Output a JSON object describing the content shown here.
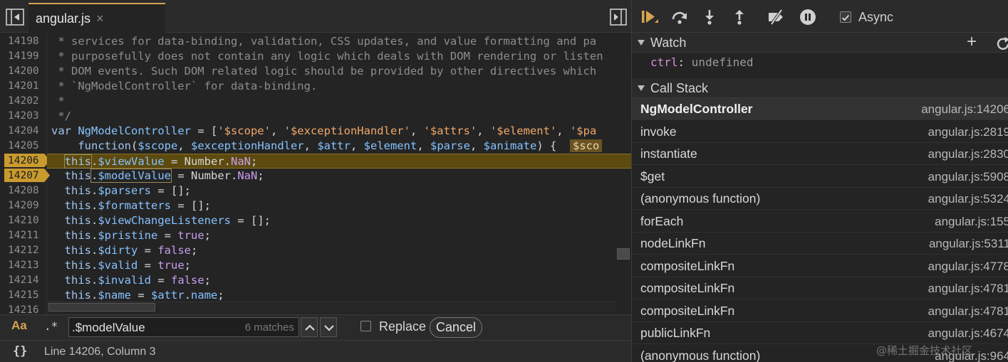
{
  "editor": {
    "file_tab": {
      "name": "angular.js",
      "close": "×"
    },
    "gutter": [
      "14198",
      "14199",
      "14200",
      "14201",
      "14202",
      "14203",
      "14204",
      "14205",
      "14206",
      "14207",
      "14208",
      "14209",
      "14210",
      "14211",
      "14212",
      "14213",
      "14214",
      "14215",
      "14216"
    ],
    "breakpoints": [
      "14206",
      "14207"
    ],
    "code": {
      "l14197": " * services for data-binding, validation, CSS updates, and value formatting and pa",
      "l14198": " * purposefully does not contain any logic which deals with DOM rendering or listen",
      "l14199": " * DOM events. Such DOM related logic should be provided by other directives which",
      "l14200": " * `NgModelController` for data-binding.",
      "l14201": " *",
      "l14202": " */",
      "l14204_kw": "var",
      "l14204_id": "NgModelController",
      "l14204_eq": " = [",
      "l14204_s1": "'$scope'",
      "l14204_s2": "'$exceptionHandler'",
      "l14204_s3": "'$attrs'",
      "l14204_s4": "'$element'",
      "l14204_s5": "'$pa",
      "l14205_fn": "function",
      "l14205_p1": "$scope",
      "l14205_p2": "$exceptionHandler",
      "l14205_p3": "$attr",
      "l14205_p4": "$element",
      "l14205_p5": "$parse",
      "l14205_p6": "$animate",
      "l14205_inline": "$sco",
      "this": "this",
      "viewValue": "$viewValue",
      "modelValue": "$modelValue",
      "parsers": "$parsers",
      "formatters": "$formatters",
      "listeners": "$viewChangeListeners",
      "pristine": "$pristine",
      "dirty": "$dirty",
      "valid": "$valid",
      "invalid": "$invalid",
      "name": "$name",
      "attr": "$attr",
      "attr_name": "name",
      "number": "Number",
      "nan": "NaN",
      "true_kw": "true",
      "false_kw": "false",
      "empty_arr": "[]"
    },
    "search": {
      "case_label": "Aa",
      "regex_label": ".*",
      "value": ".$modelValue",
      "matches": "6 matches",
      "replace_label": "Replace",
      "cancel_label": "Cancel"
    },
    "status": {
      "braces": "{}",
      "cursor": "Line 14206, Column 3"
    }
  },
  "debugger": {
    "async_label": "Async",
    "watch": {
      "title": "Watch",
      "add": "+",
      "items": [
        {
          "name": "ctrl",
          "sep": ": ",
          "value": "undefined"
        }
      ]
    },
    "call_stack": {
      "title": "Call Stack",
      "frames": [
        {
          "name": "NgModelController",
          "loc": "angular.js:14206"
        },
        {
          "name": "invoke",
          "loc": "angular.js:2819"
        },
        {
          "name": "instantiate",
          "loc": "angular.js:2830"
        },
        {
          "name": "$get",
          "loc": "angular.js:5908"
        },
        {
          "name": "(anonymous function)",
          "loc": "angular.js:5324"
        },
        {
          "name": "forEach",
          "loc": "angular.js:155"
        },
        {
          "name": "nodeLinkFn",
          "loc": "angular.js:5311"
        },
        {
          "name": "compositeLinkFn",
          "loc": "angular.js:4778"
        },
        {
          "name": "compositeLinkFn",
          "loc": "angular.js:4781"
        },
        {
          "name": "compositeLinkFn",
          "loc": "angular.js:4781"
        },
        {
          "name": "publicLinkFn",
          "loc": "angular.js:4674"
        },
        {
          "name": "(anonymous function)",
          "loc": "angular.js:964"
        }
      ]
    }
  },
  "watermark": "@稀土掘金技术社区",
  "colors": {
    "accent": "#d7a552",
    "exec_line": "#5c4a0e",
    "breakpoint": "#c99a2e"
  }
}
